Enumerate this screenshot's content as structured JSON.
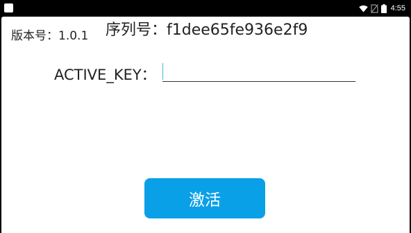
{
  "status_bar": {
    "time": "4:55",
    "icons": [
      "notification-icon",
      "wifi-icon",
      "no-sim-icon",
      "battery-icon"
    ]
  },
  "app": {
    "version_label": "版本号：1.0.1",
    "serial_label": "序列号：f1dee65fe936e2f9",
    "key_label": "ACTIVE_KEY：",
    "key_input": {
      "value": "",
      "placeholder": ""
    },
    "activate_button": "激活"
  },
  "colors": {
    "accent": "#0aa0e8",
    "background": "#ffffff",
    "status_bar": "#000000",
    "cursor": "#3fb6c8"
  }
}
